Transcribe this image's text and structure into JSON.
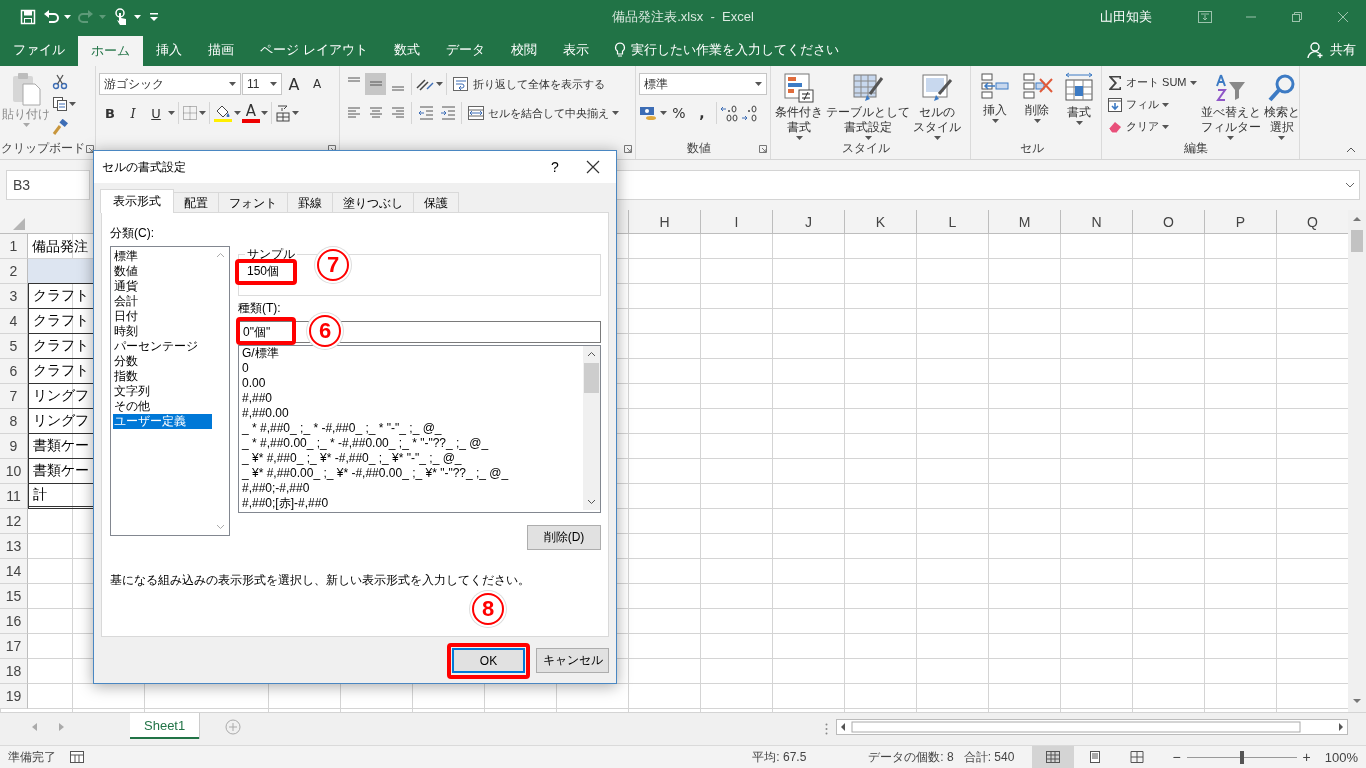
{
  "title_bar": {
    "quick_access": [
      {
        "kind": "save",
        "disabled": false,
        "dropdown": false
      },
      {
        "kind": "undo",
        "disabled": false,
        "dropdown": true
      },
      {
        "kind": "redo",
        "disabled": true,
        "dropdown": true
      },
      {
        "kind": "touch",
        "disabled": false,
        "dropdown": true
      },
      {
        "kind": "customize",
        "disabled": false,
        "dropdown": false
      }
    ],
    "title": "備品発注表.xlsx  -  Excel",
    "user": "山田知美"
  },
  "menu_tabs": [
    {
      "label": "ファイル",
      "selected": false
    },
    {
      "label": "ホーム",
      "selected": true
    },
    {
      "label": "挿入",
      "selected": false
    },
    {
      "label": "描画",
      "selected": false
    },
    {
      "label": "ページ レイアウト",
      "selected": false
    },
    {
      "label": "数式",
      "selected": false
    },
    {
      "label": "データ",
      "selected": false
    },
    {
      "label": "校閲",
      "selected": false
    },
    {
      "label": "表示",
      "selected": false
    }
  ],
  "tell_me": "実行したい作業を入力してください",
  "share": "共有",
  "ribbon": {
    "clipboard": {
      "paste": {
        "label": "貼り付け",
        "disabled": true
      },
      "label": "クリップボード"
    },
    "font": {
      "font_name": "游ゴシック",
      "font_size": "11",
      "grow": "A",
      "shrink": "A",
      "bold": "B",
      "italic": "I",
      "underline": "U",
      "font_color": "A"
    },
    "alignment": {
      "vertical": [
        {
          "selected": false
        },
        {
          "selected": true
        },
        {
          "selected": false
        }
      ],
      "wrap_text": "折り返して全体を表示する",
      "merge_center": "セルを結合して中央揃え"
    },
    "number": {
      "format": "標準",
      "percent": "%",
      "comma": ",",
      "label": "数値"
    },
    "styles": {
      "buttons": [
        {
          "kind": "conditional",
          "lines": [
            "条件付き",
            "書式"
          ]
        },
        {
          "kind": "table",
          "lines": [
            "テーブルとして",
            "書式設定"
          ]
        },
        {
          "kind": "cell_styles",
          "lines": [
            "セルの",
            "スタイル"
          ]
        }
      ],
      "label": "スタイル"
    },
    "cells": {
      "buttons": [
        {
          "kind": "insert",
          "lines": [
            "挿入"
          ]
        },
        {
          "kind": "delete",
          "lines": [
            "削除"
          ]
        },
        {
          "kind": "format",
          "lines": [
            "書式"
          ]
        }
      ],
      "label": "セル"
    },
    "editing": {
      "commands": [
        {
          "kind": "autosum",
          "label": "オート SUM"
        },
        {
          "kind": "fill",
          "label": "フィル"
        },
        {
          "kind": "clear",
          "label": "クリア"
        }
      ],
      "buttons": [
        {
          "kind": "sort",
          "lines": [
            "並べ替えと",
            "フィルター"
          ]
        },
        {
          "kind": "find",
          "lines": [
            "検索と",
            "選択"
          ]
        }
      ],
      "label": "編集"
    }
  },
  "formula_bar": {
    "name_box": "B3"
  },
  "sheet": {
    "columns": [
      "H",
      "I",
      "J",
      "K",
      "L",
      "M",
      "N",
      "O",
      "P",
      "Q"
    ],
    "rows": [
      {
        "header": "1",
        "kind": "plain",
        "cell_a": "備品発注"
      },
      {
        "header": "2",
        "kind": "band"
      },
      {
        "header": "3",
        "kind": "boxed",
        "cell_a": "クラフト"
      },
      {
        "header": "4",
        "kind": "boxed",
        "cell_a": "クラフト"
      },
      {
        "header": "5",
        "kind": "boxed",
        "cell_a": "クラフト"
      },
      {
        "header": "6",
        "kind": "boxed",
        "cell_a": "クラフト"
      },
      {
        "header": "7",
        "kind": "boxed",
        "cell_a": "リングフ"
      },
      {
        "header": "8",
        "kind": "boxed",
        "cell_a": "リングフ"
      },
      {
        "header": "9",
        "kind": "boxed",
        "cell_a": "書類ケー"
      },
      {
        "header": "10",
        "kind": "boxed",
        "cell_a": "書類ケー"
      },
      {
        "header": "11",
        "kind": "total",
        "cell_a": "計"
      },
      {
        "header": "12",
        "kind": "plain"
      },
      {
        "header": "13",
        "kind": "plain"
      },
      {
        "header": "14",
        "kind": "plain"
      },
      {
        "header": "15",
        "kind": "plain"
      },
      {
        "header": "16",
        "kind": "plain"
      },
      {
        "header": "17",
        "kind": "plain"
      },
      {
        "header": "18",
        "kind": "plain"
      },
      {
        "header": "19",
        "kind": "plain"
      }
    ]
  },
  "sheet_tabs": [
    {
      "label": "Sheet1",
      "selected": true
    }
  ],
  "status_bar": {
    "ready": "準備完了",
    "average": "平均: 67.5",
    "count": "データの個数: 8",
    "sum": "合計: 540",
    "views": [
      {
        "kind": "normal",
        "selected": true
      },
      {
        "kind": "page_layout",
        "selected": false
      },
      {
        "kind": "page_break",
        "selected": false
      }
    ],
    "zoom_out": "−",
    "zoom_in": "+",
    "zoom": {
      "level": 0.5
    },
    "zoom_percent": "100%"
  },
  "dialog": {
    "title": "セルの書式設定",
    "help": "?",
    "tabs": [
      {
        "label": "表示形式",
        "selected": true
      },
      {
        "label": "配置",
        "selected": false
      },
      {
        "label": "フォント",
        "selected": false
      },
      {
        "label": "罫線",
        "selected": false
      },
      {
        "label": "塗りつぶし",
        "selected": false
      },
      {
        "label": "保護",
        "selected": false
      }
    ],
    "category_label": "分類(C):",
    "categories": [
      {
        "label": "標準",
        "selected": false
      },
      {
        "label": "数値",
        "selected": false
      },
      {
        "label": "通貨",
        "selected": false
      },
      {
        "label": "会計",
        "selected": false
      },
      {
        "label": "日付",
        "selected": false
      },
      {
        "label": "時刻",
        "selected": false
      },
      {
        "label": "パーセンテージ",
        "selected": false
      },
      {
        "label": "分数",
        "selected": false
      },
      {
        "label": "指数",
        "selected": false
      },
      {
        "label": "文字列",
        "selected": false
      },
      {
        "label": "その他",
        "selected": false
      },
      {
        "label": "ユーザー定義",
        "selected": true
      }
    ],
    "sample_label": "サンプル",
    "sample": "150個",
    "type_label": "種類(T):",
    "type_value": "0\"個\"",
    "formats": [
      "G/標準",
      "0",
      "0.00",
      "#,##0",
      "#,##0.00",
      "_ * #,##0_ ;_ * -#,##0_ ;_ * \"-\"_ ;_ @_",
      "_ * #,##0.00_ ;_ * -#,##0.00_ ;_ * \"-\"??_ ;_ @_",
      "_ ¥* #,##0_ ;_ ¥* -#,##0_ ;_ ¥* \"-\"_ ;_ @_",
      "_ ¥* #,##0.00_ ;_ ¥* -#,##0.00_ ;_ ¥* \"-\"??_ ;_ @_",
      "#,##0;-#,##0",
      "#,##0;[赤]-#,##0"
    ],
    "delete": "削除(D)",
    "description": "基になる組み込みの表示形式を選択し、新しい表示形式を入力してください。",
    "ok": "OK",
    "cancel": "キャンセル",
    "callouts": [
      {
        "kind": "sample",
        "number": "7"
      },
      {
        "kind": "type",
        "number": "6"
      },
      {
        "kind": "ok",
        "number": "8"
      }
    ]
  }
}
